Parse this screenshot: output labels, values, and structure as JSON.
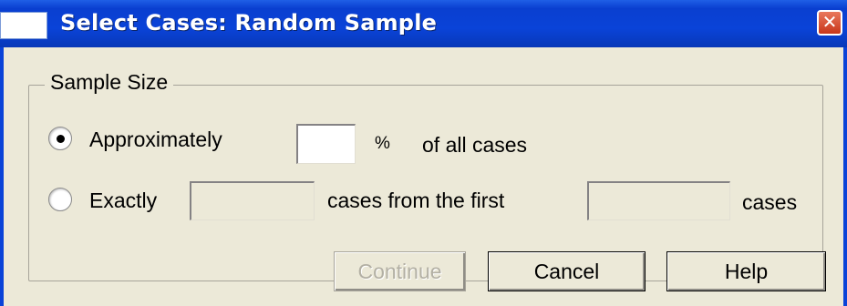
{
  "window": {
    "title": "Select Cases: Random Sample",
    "close_symbol": "✕"
  },
  "sample_size": {
    "group_label": "Sample Size",
    "approximately": {
      "label": "Approximately",
      "selected": true,
      "value": "",
      "unit": "%",
      "suffix": "of all cases"
    },
    "exactly": {
      "label": "Exactly",
      "selected": false,
      "cases_value": "",
      "middle_text": "cases from the first",
      "first_value": "",
      "suffix": "cases"
    }
  },
  "buttons": {
    "continue": "Continue",
    "cancel": "Cancel",
    "help": "Help"
  }
}
